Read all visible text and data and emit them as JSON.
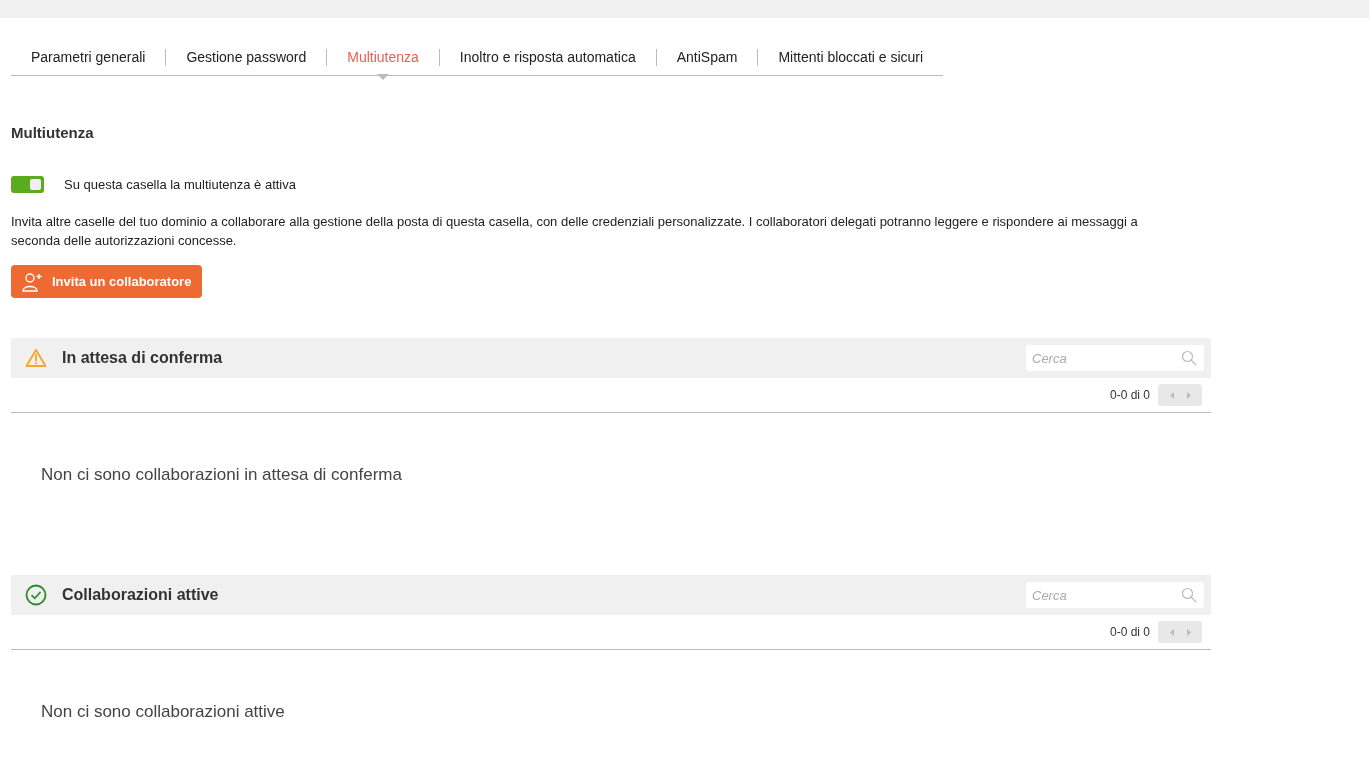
{
  "tabs": [
    {
      "label": "Parametri generali",
      "selected": false
    },
    {
      "label": "Gestione password",
      "selected": false
    },
    {
      "label": "Multiutenza",
      "selected": true
    },
    {
      "label": "Inoltro e risposta automatica",
      "selected": false
    },
    {
      "label": "AntiSpam",
      "selected": false
    },
    {
      "label": "Mittenti bloccati e sicuri",
      "selected": false
    }
  ],
  "section_title": "Multiutenza",
  "toggle": {
    "label": "Su questa casella la multiutenza è attiva",
    "on": true
  },
  "description": "Invita altre caselle del tuo dominio a collaborare alla gestione della posta di questa casella, con delle credenziali personalizzate. I collaboratori delegati potranno leggere e rispondere ai messaggi a seconda delle autorizzazioni concesse.",
  "invite_button": "Invita un collaboratore",
  "panels": [
    {
      "kind": "pending",
      "title": "In attesa di conferma",
      "search": {
        "placeholder": "Cerca"
      },
      "pagination": "0-0 di 0",
      "empty_message": "Non ci sono collaborazioni in attesa di conferma"
    },
    {
      "kind": "active",
      "title": "Collaborazioni attive",
      "search": {
        "placeholder": "Cerca"
      },
      "pagination": "0-0 di 0",
      "empty_message": "Non ci sono collaborazioni attive"
    }
  ]
}
